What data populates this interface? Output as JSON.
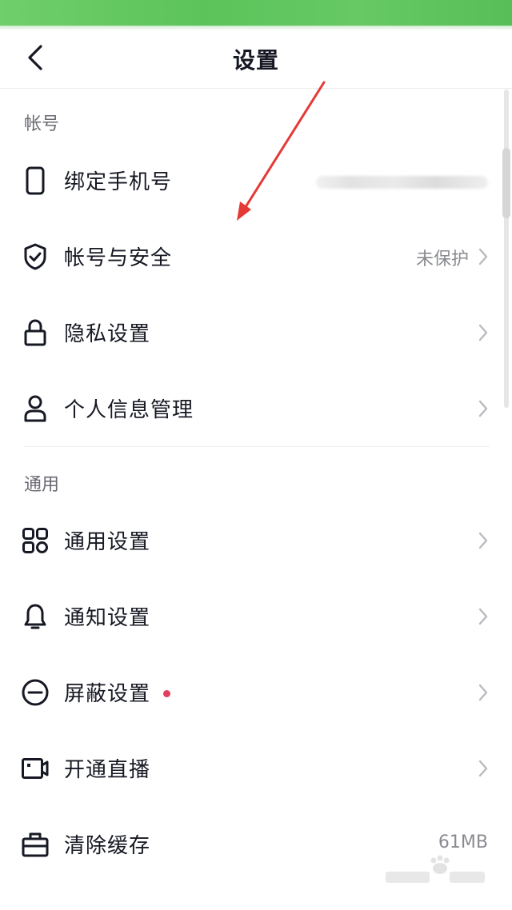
{
  "header": {
    "title": "设置"
  },
  "sections": {
    "account": {
      "title": "帐号",
      "items": [
        {
          "label": "绑定手机号",
          "icon": "phone-icon"
        },
        {
          "label": "帐号与安全",
          "value": "未保护",
          "icon": "shield-check-icon"
        },
        {
          "label": "隐私设置",
          "icon": "lock-icon"
        },
        {
          "label": "个人信息管理",
          "icon": "person-icon"
        }
      ]
    },
    "general": {
      "title": "通用",
      "items": [
        {
          "label": "通用设置",
          "icon": "grid-icon"
        },
        {
          "label": "通知设置",
          "icon": "bell-icon"
        },
        {
          "label": "屏蔽设置",
          "icon": "block-icon",
          "has_dot": true
        },
        {
          "label": "开通直播",
          "icon": "video-camera-icon"
        },
        {
          "label": "清除缓存",
          "value": "61MB",
          "icon": "toolbox-icon"
        }
      ]
    }
  },
  "colors": {
    "status_bar": "#5cc35a",
    "dot": "#e0405e",
    "annotation_arrow": "#e53935"
  }
}
